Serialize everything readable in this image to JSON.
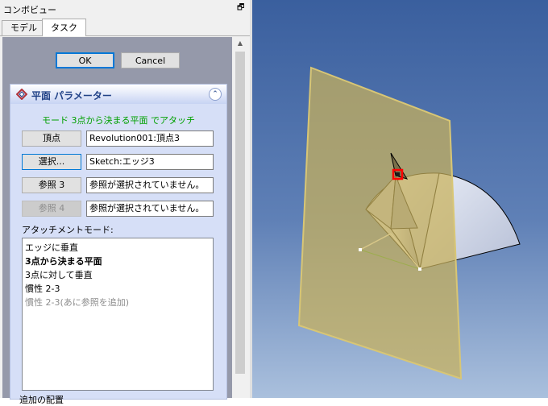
{
  "combo": {
    "title": "コンボビュー",
    "tabs": [
      {
        "label": "モデル"
      },
      {
        "label": "タスク"
      }
    ]
  },
  "dialog": {
    "ok_label": "OK",
    "cancel_label": "Cancel"
  },
  "panel": {
    "title": "平面 パラメーター",
    "mode_text": "モード 3点から決まる平面 でアタッチ",
    "references": [
      {
        "button": "頂点",
        "value": "Revolution001:頂点3"
      },
      {
        "button": "選択...",
        "value": "Sketch:エッジ3"
      },
      {
        "button": "参照 3",
        "value": "参照が選択されていません。"
      },
      {
        "button": "参照 4",
        "value": "参照が選択されていません。"
      }
    ],
    "attach_label": "アタッチメントモード:",
    "modes": [
      "エッジに垂直",
      "3点から決まる平面",
      "3点に対して垂直",
      "慣性 2-3",
      "慣性 2-3(あに参照を追加)"
    ],
    "bottom_text": "追加の配置"
  },
  "colors": {
    "plane_fill": "#c9b25a",
    "plane_edge": "#d8c675",
    "selection": "#ff0000",
    "mode_text": "#00a000",
    "viewport_bg": "#4b6ea8"
  }
}
